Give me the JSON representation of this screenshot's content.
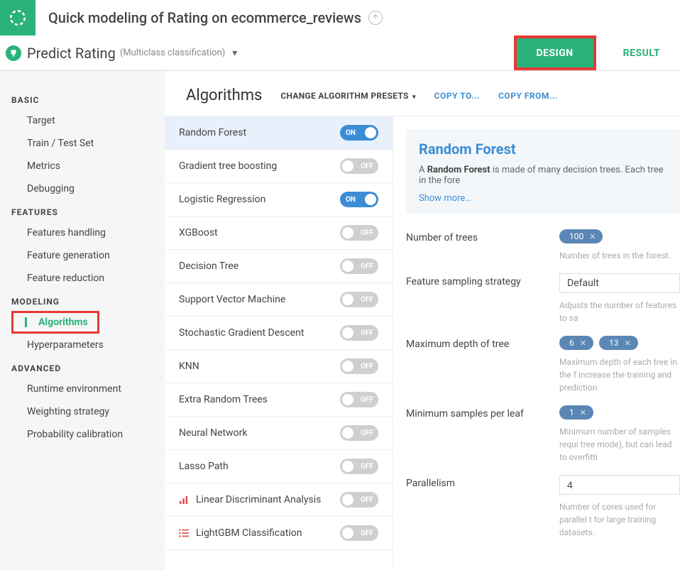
{
  "header": {
    "title": "Quick modeling of Rating on ecommerce_reviews"
  },
  "subheader": {
    "predict_label": "Predict Rating",
    "classification_label": "(Multiclass classification)",
    "tabs": {
      "design": "DESIGN",
      "result": "RESULT"
    }
  },
  "sidebar": {
    "groups": [
      {
        "head": "BASIC",
        "items": [
          "Target",
          "Train / Test Set",
          "Metrics",
          "Debugging"
        ]
      },
      {
        "head": "FEATURES",
        "items": [
          "Features handling",
          "Feature generation",
          "Feature reduction"
        ]
      },
      {
        "head": "MODELING",
        "items": [
          "Algorithms",
          "Hyperparameters"
        ]
      },
      {
        "head": "ADVANCED",
        "items": [
          "Runtime environment",
          "Weighting strategy",
          "Probability calibration"
        ]
      }
    ]
  },
  "content": {
    "title": "Algorithms",
    "presets_label": "CHANGE ALGORITHM PRESETS",
    "copy_to": "COPY TO...",
    "copy_from": "COPY FROM..."
  },
  "algorithms": [
    {
      "name": "Random Forest",
      "on": true,
      "selected": true
    },
    {
      "name": "Gradient tree boosting",
      "on": false
    },
    {
      "name": "Logistic Regression",
      "on": true
    },
    {
      "name": "XGBoost",
      "on": false
    },
    {
      "name": "Decision Tree",
      "on": false
    },
    {
      "name": "Support Vector Machine",
      "on": false
    },
    {
      "name": "Stochastic Gradient Descent",
      "on": false
    },
    {
      "name": "KNN",
      "on": false
    },
    {
      "name": "Extra Random Trees",
      "on": false
    },
    {
      "name": "Neural Network",
      "on": false
    },
    {
      "name": "Lasso Path",
      "on": false
    },
    {
      "name": "Linear Discriminant Analysis",
      "on": false,
      "icon": "bars"
    },
    {
      "name": "LightGBM Classification",
      "on": false,
      "icon": "list"
    }
  ],
  "toggle_labels": {
    "on": "ON",
    "off": "OFF"
  },
  "panel": {
    "title": "Random Forest",
    "desc_prefix": "A ",
    "desc_bold": "Random Forest",
    "desc_rest": " is made of many decision trees. Each tree in the fore",
    "show_more": "Show more…",
    "params": {
      "num_trees": {
        "label": "Number of trees",
        "pill": "100",
        "hint": "Number of trees in the forest."
      },
      "feature_sampling": {
        "label": "Feature sampling strategy",
        "value": "Default",
        "hint": "Adjusts the number of features to sa"
      },
      "max_depth": {
        "label": "Maximum depth of tree",
        "pills": [
          "6",
          "13"
        ],
        "hint": "Maximum depth of each tree in the f increase the training and prediction"
      },
      "min_samples": {
        "label": "Minimum samples per leaf",
        "pill": "1",
        "hint": "Minimum number of samples requi tree mode), but can lead to overfitti"
      },
      "parallelism": {
        "label": "Parallelism",
        "value": "4",
        "hint": "Number of cores used for parallel t for large training datasets."
      }
    }
  }
}
